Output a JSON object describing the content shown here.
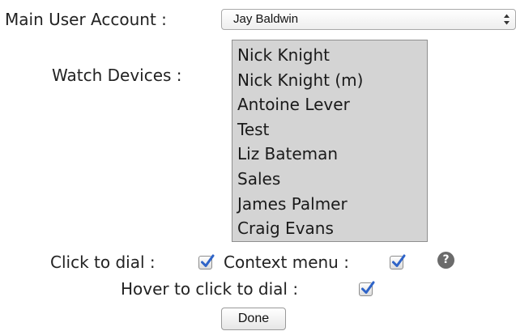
{
  "main_user": {
    "label": "Main User Account :",
    "selected": "Jay Baldwin"
  },
  "watch_devices": {
    "label": "Watch Devices :",
    "options": [
      "Nick Knight",
      "Nick Knight (m)",
      "Antoine Lever",
      "Test",
      "Liz Bateman",
      "Sales",
      "James Palmer",
      "Craig Evans"
    ]
  },
  "click_to_dial": {
    "label": "Click to dial :",
    "checked": true
  },
  "context_menu": {
    "label": "Context menu :",
    "checked": true
  },
  "hover_to_click": {
    "label": "Hover to click to dial :",
    "checked": true
  },
  "help_icon": {
    "symbol": "?"
  },
  "done_button": {
    "label": "Done"
  },
  "colors": {
    "listbox_bg": "#d4d4d4",
    "checkmark": "#2f64c8",
    "help_icon_bg": "#6b6b6b"
  }
}
